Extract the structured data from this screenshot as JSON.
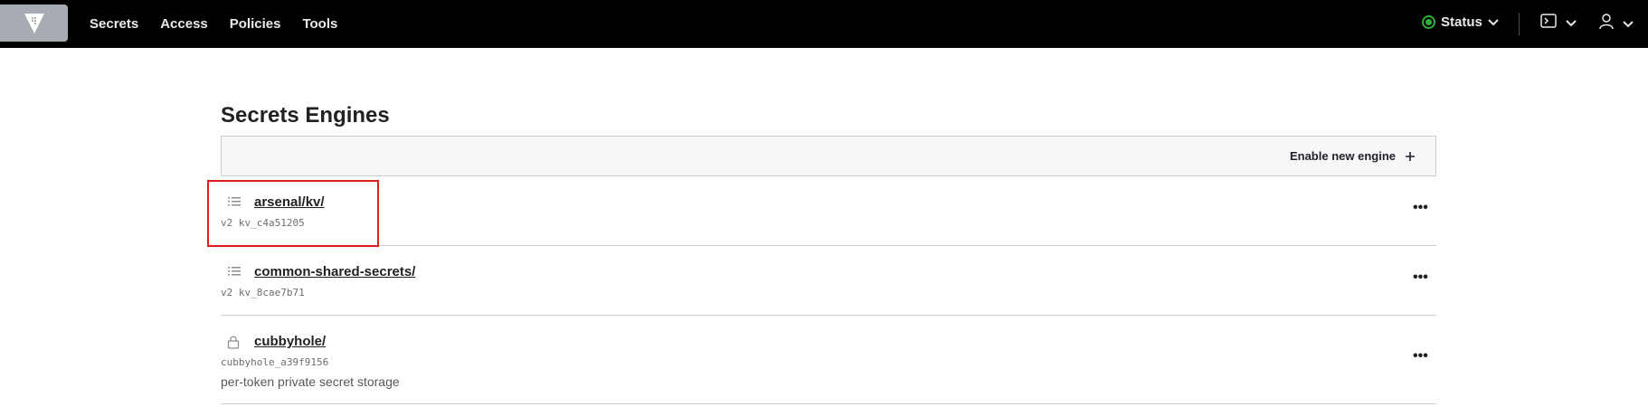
{
  "nav": {
    "links": [
      "Secrets",
      "Access",
      "Policies",
      "Tools"
    ],
    "status_label": "Status",
    "status_color": "#2eb039",
    "logo_icon": "vault-logo-icon",
    "console_icon": "terminal-icon",
    "user_icon": "user-icon"
  },
  "page": {
    "title": "Secrets Engines",
    "enable_label": "Enable new engine",
    "enable_icon": "plus-icon"
  },
  "engines": [
    {
      "path": "arsenal/kv/",
      "meta": "v2 kv_c4a51205",
      "description": "",
      "icon": "list-icon",
      "more": "•••"
    },
    {
      "path": "common-shared-secrets/",
      "meta": "v2 kv_8cae7b71",
      "description": "",
      "icon": "list-icon",
      "more": "•••"
    },
    {
      "path": "cubbyhole/",
      "meta": "cubbyhole_a39f9156",
      "description": "per-token private secret storage",
      "icon": "lock-icon",
      "more": "•••"
    }
  ],
  "colors": {
    "nav_bg": "#000000",
    "highlight": "#e01c1c"
  }
}
